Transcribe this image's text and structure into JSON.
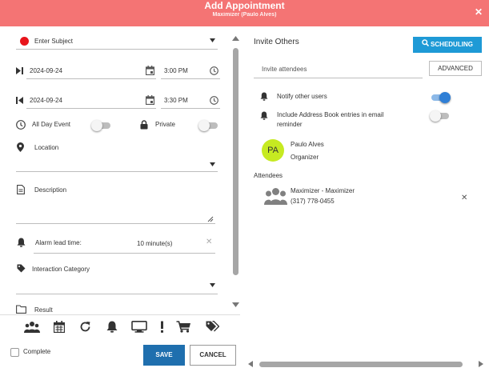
{
  "dialog": {
    "title": "Add Appointment",
    "subtitle": "Maximizer (Paulo Alves)"
  },
  "subject": {
    "placeholder": "Enter Subject",
    "color": "#e8141b"
  },
  "start": {
    "date": "2024-09-24",
    "time": "3:00 PM"
  },
  "end": {
    "date": "2024-09-24",
    "time": "3:30 PM"
  },
  "all_day": {
    "label": "All Day Event",
    "on": false
  },
  "private": {
    "label": "Private",
    "on": false
  },
  "location": {
    "label": "Location"
  },
  "description": {
    "label": "Description"
  },
  "alarm": {
    "label": "Alarm lead time:",
    "value": "10 minute(s)"
  },
  "interaction": {
    "label": "Interaction Category"
  },
  "result": {
    "label": "Result"
  },
  "toolbar": {
    "icons": [
      "attendees-icon",
      "calendar-icon",
      "recurrence-icon",
      "alarm-bell-icon",
      "monitor-icon",
      "priority-icon",
      "cart-icon",
      "tags-icon"
    ]
  },
  "complete": {
    "label": "Complete",
    "checked": false
  },
  "footer": {
    "save_label": "SAVE",
    "cancel_label": "CANCEL"
  },
  "invite": {
    "title": "Invite Others",
    "scheduling_label": "SCHEDULING",
    "attendee_placeholder": "Invite attendees",
    "advanced_label": "ADVANCED",
    "notify_label": "Notify other users",
    "notify_on": true,
    "address_book_label_1": "Include Address Book entries in email",
    "address_book_label_2": "reminder",
    "address_book_on": false
  },
  "organizer": {
    "initials": "PA",
    "name": "Paulo Alves",
    "role": "Organizer"
  },
  "attendees": {
    "heading": "Attendees",
    "items": [
      {
        "name": "Maximizer - Maximizer",
        "phone": "(317) 778-0455"
      }
    ]
  },
  "colors": {
    "titlebar": "#f47474",
    "accent": "#1e9ad6",
    "save": "#1f6fae",
    "toggle_on": "#2f7fd6",
    "avatar": "#c6ea21"
  }
}
